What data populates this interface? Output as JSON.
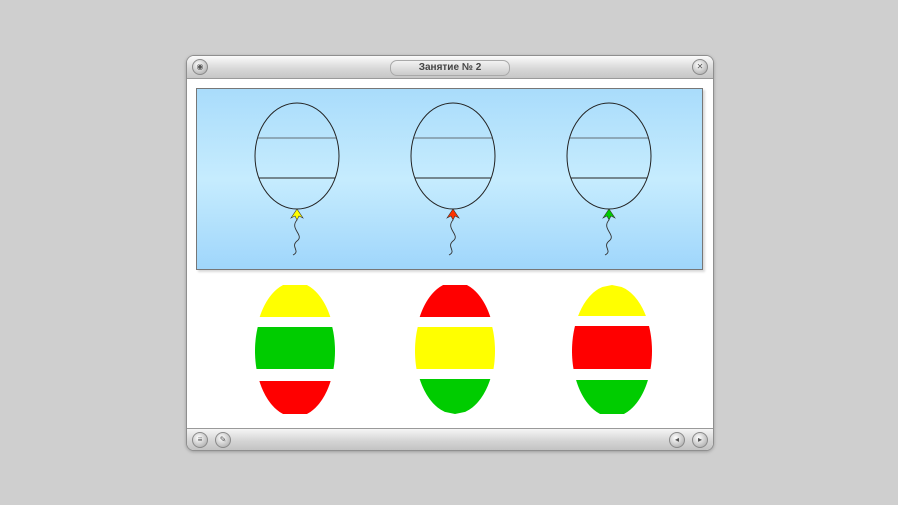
{
  "window": {
    "title": "Занятие № 2"
  },
  "colors": {
    "yellow": "#ffff00",
    "red": "#ff0000",
    "green": "#00cc00",
    "sky_top": "#a9dcfb",
    "sky_mid": "#c6ecfe"
  },
  "balloons": [
    {
      "knot_color": "#ffff00"
    },
    {
      "knot_color": "#ff3300"
    },
    {
      "knot_color": "#00cc00"
    }
  ],
  "piece_columns": [
    {
      "top": "#ffff00",
      "middle": "#00cc00",
      "bottom": "#ff0000"
    },
    {
      "top": "#ff0000",
      "middle": "#ffff00",
      "bottom": "#00cc00"
    },
    {
      "top": "#ffff00",
      "middle": "#ff0000",
      "bottom": "#00cc00"
    }
  ],
  "titlebar_icons": {
    "left": "window-menu-icon",
    "right": "close-icon"
  },
  "bottombar_icons": [
    "menu-icon",
    "edit-icon",
    "back-icon",
    "forward-icon"
  ]
}
